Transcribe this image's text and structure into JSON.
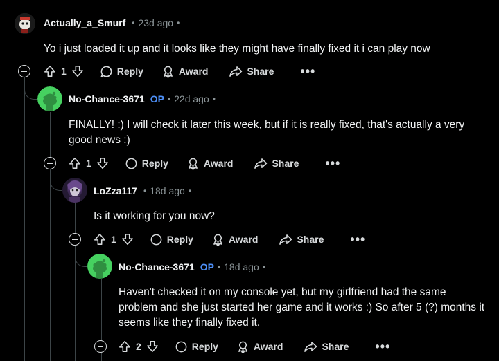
{
  "comments": [
    {
      "username": "Actually_a_Smurf",
      "op": "",
      "time": "23d ago",
      "body": "Yo i just loaded it up and it looks like they might have finally fixed it i can play now",
      "votes": "1"
    },
    {
      "username": "No-Chance-3671",
      "op": "OP",
      "time": "22d ago",
      "body": "FINALLY! :) I will check it later this week, but if it is really fixed, that's actually a very good news :)",
      "votes": "1"
    },
    {
      "username": "LoZza117",
      "op": "",
      "time": "18d ago",
      "body": "Is it working for you now?",
      "votes": "1"
    },
    {
      "username": "No-Chance-3671",
      "op": "OP",
      "time": "18d ago",
      "body": "Haven't checked it on my console yet, but my girlfriend had the same problem and she just started her game and it works :) So after 5 (?) months it seems like they finally fixed it.",
      "votes": "2"
    }
  ],
  "actions": {
    "reply": "Reply",
    "award": "Award",
    "share": "Share",
    "more": "•••"
  },
  "colors": {
    "background": "#000000",
    "op_badge": "#4d8ff7",
    "snoo_avatar_bg": "#46d160",
    "meta": "#8a9396"
  }
}
